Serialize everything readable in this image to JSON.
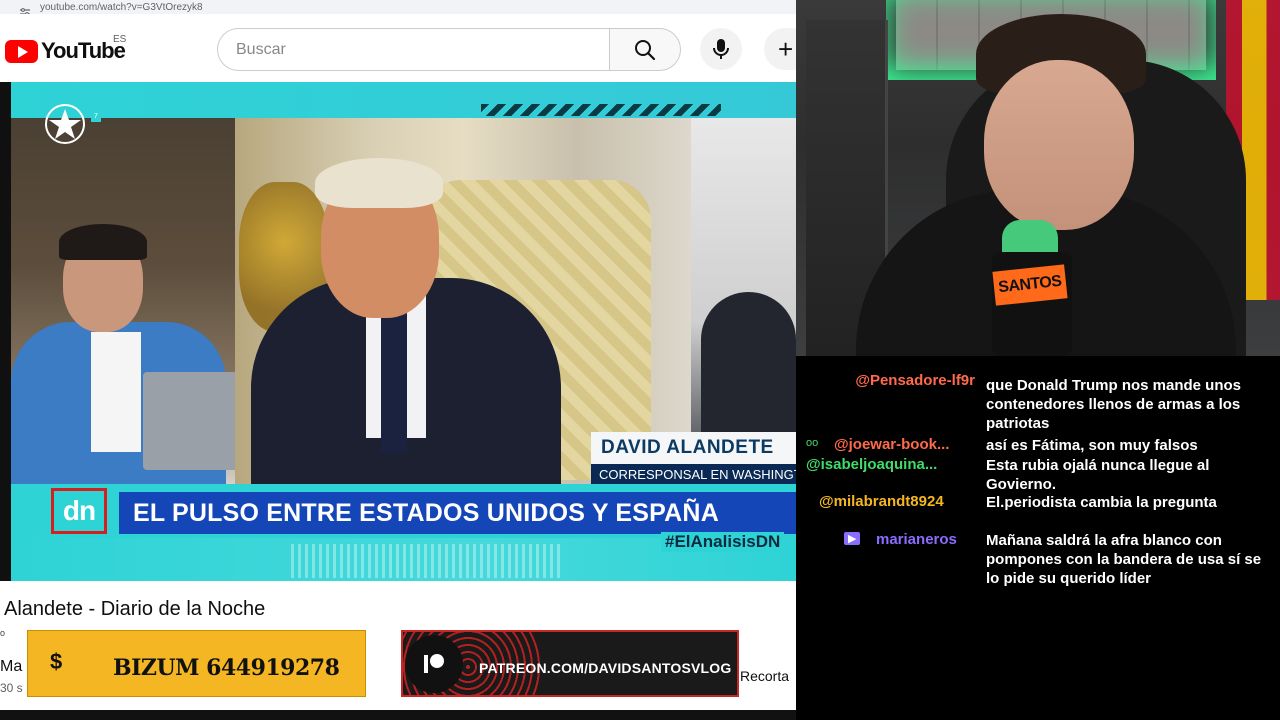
{
  "browser": {
    "url": "youtube.com/watch?v=G3VtOrezyk8"
  },
  "youtube": {
    "logo_text": "YouTube",
    "region": "ES",
    "search_placeholder": "Buscar",
    "create_label": "+"
  },
  "broadcast": {
    "channel_number": "7",
    "name_plate": "DAVID ALANDETE",
    "role_plate": "CORRESPONSAL EN WASHINGTON",
    "program_logo": "dn",
    "headline": "EL PULSO ENTRE ESTADOS UNIDOS Y ESPAÑA",
    "hashtag": "#ElAnalisisDN"
  },
  "below_video": {
    "title": "Alandete - Diario de la Noche",
    "tiny_char": "o",
    "channel_abbrev": "Ma",
    "sub_count_abbrev": "30 s",
    "clip_button": "Recorta"
  },
  "overlays": {
    "bizum_symbol": "$",
    "bizum_text": "BIZUM 644919278",
    "patreon_text": "PATREON.COM/DAVIDSANTOSVLOG"
  },
  "webcam": {
    "mic_brand": "SANTOS"
  },
  "chat": {
    "messages": [
      {
        "user": "@Pensadore-lf9r",
        "user_color": "#ff6a4a",
        "text": "que Donald Trump nos mande unos contenedores llenos de armas a los patriotas",
        "badge": ""
      },
      {
        "user": "@joewar-book...",
        "user_color": "#ff6a4a",
        "text": "así es Fátima, son muy falsos",
        "badge": "oo"
      },
      {
        "user": "@isabeljoaquina...",
        "user_color": "#3fdc6a",
        "text": "Esta rubia ojalá nunca llegue al Govierno.",
        "badge": ""
      },
      {
        "user": "@milabrandt8924",
        "user_color": "#f5b623",
        "text": "El.periodista cambia la pregunta",
        "badge": ""
      },
      {
        "user": "marianeros",
        "user_color": "#8a6cff",
        "text": "Mañana saldrá la afra blanco con pompones con la bandera de usa sí se lo pide su querido líder",
        "badge": "▶"
      }
    ]
  }
}
